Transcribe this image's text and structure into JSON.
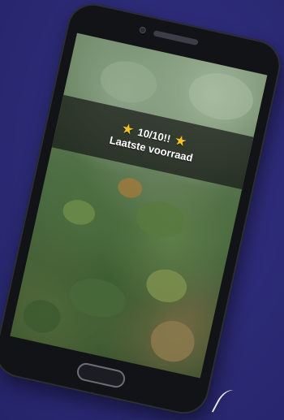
{
  "banner": {
    "line1": "10/10!!",
    "line2": "Laatste voorraad",
    "star_color": "#f2c028"
  },
  "icons": {
    "star": "star-icon"
  },
  "colors": {
    "background": "#2b2a74",
    "phone_body": "#121317",
    "banner_text": "#ffffff"
  }
}
